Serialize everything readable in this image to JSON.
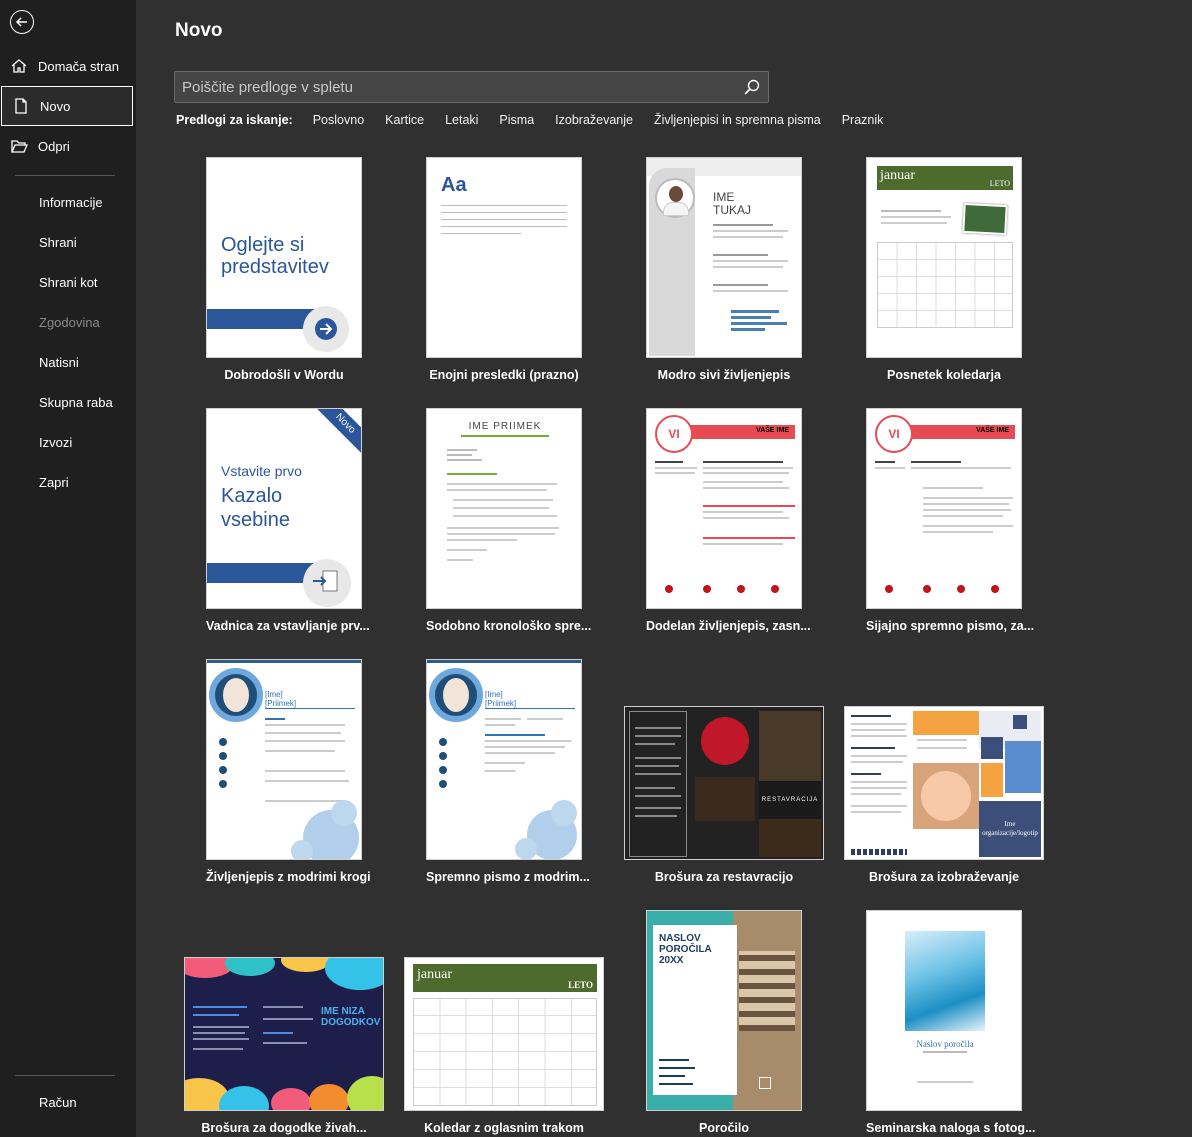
{
  "sidebar": {
    "back_label": "",
    "items": [
      {
        "label": "Domača stran",
        "icon": "home-icon"
      },
      {
        "label": "Novo",
        "icon": "new-document-icon"
      },
      {
        "label": "Odpri",
        "icon": "open-folder-icon"
      },
      {
        "label": "Informacije"
      },
      {
        "label": "Shrani"
      },
      {
        "label": "Shrani kot"
      },
      {
        "label": "Zgodovina"
      },
      {
        "label": "Natisni"
      },
      {
        "label": "Skupna raba"
      },
      {
        "label": "Izvozi"
      },
      {
        "label": "Zapri"
      },
      {
        "label": "Račun"
      }
    ]
  },
  "main": {
    "title": "Novo",
    "search": {
      "placeholder": "Poiščite predloge v spletu",
      "value": ""
    },
    "suggested": {
      "label": "Predlogi za iskanje:",
      "links": [
        "Poslovno",
        "Kartice",
        "Letaki",
        "Pisma",
        "Izobraževanje",
        "Življenjepisi in spremna pisma",
        "Praznik"
      ]
    },
    "templates": [
      {
        "caption": "Dobrodošli v Wordu",
        "thumb_text": [
          "Oglejte si",
          "predstavitev"
        ]
      },
      {
        "caption": "Enojni presledki (prazno)",
        "thumb_text": [
          "Aa"
        ]
      },
      {
        "caption": "Modro sivi življenjepis",
        "thumb_text": [
          "IME",
          "TUKAJ"
        ]
      },
      {
        "caption": "Posnetek koledarja",
        "thumb_text": [
          "januar",
          "LETO"
        ]
      },
      {
        "caption": "Vadnica za vstavljanje prv...",
        "thumb_text": [
          "Vstavite prvo",
          "Kazalo",
          "vsebine",
          "Novo"
        ]
      },
      {
        "caption": "Sodobno kronološko spre...",
        "thumb_text": [
          "IME PRIIMEK"
        ]
      },
      {
        "caption": "Dodelan življenjepis, zasn...",
        "thumb_text": [
          "VI",
          "VAŠE IME"
        ]
      },
      {
        "caption": "Sijajno spremno pismo, za...",
        "thumb_text": [
          "VI",
          "VAŠE IME"
        ]
      },
      {
        "caption": "Življenjepis z modrimi krogi",
        "thumb_text": [
          "[Ime]",
          "[Priimek]"
        ]
      },
      {
        "caption": "Spremno pismo z modrim...",
        "thumb_text": [
          "[Ime]",
          "[Priimek]"
        ]
      },
      {
        "caption": "Brošura za restavracijo",
        "thumb_text": [
          "RESTAVRACIJA"
        ]
      },
      {
        "caption": "Brošura za izobraževanje",
        "thumb_text": [
          "Ime",
          "organizacije/logotip"
        ]
      },
      {
        "caption": "Brošura za dogodke živah...",
        "thumb_text": [
          "IME NIZA",
          "DOGODKOV"
        ]
      },
      {
        "caption": "Koledar z oglasnim trakom",
        "thumb_text": [
          "januar",
          "LETO"
        ]
      },
      {
        "caption": "Poročilo",
        "thumb_text": [
          "NASLOV",
          "POROČILA",
          "20XX"
        ]
      },
      {
        "caption": "Seminarska naloga s fotog...",
        "thumb_text": [
          "Naslov poročila"
        ]
      }
    ]
  },
  "colors": {
    "sidebar_bg": "#1f1f1f",
    "main_bg": "#303030",
    "word_blue": "#2b579a"
  }
}
